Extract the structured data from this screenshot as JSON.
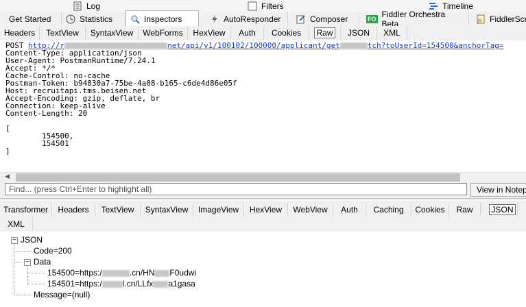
{
  "top_tabs": [
    {
      "label": "Log",
      "icon": "log-icon"
    },
    {
      "label": "Filters",
      "icon": "filters-checkbox-icon"
    },
    {
      "label": "Timeline",
      "icon": "timeline-icon"
    }
  ],
  "main_tabs": [
    {
      "label": "Get Started",
      "icon": ""
    },
    {
      "label": "Statistics",
      "icon": "statistics-icon"
    },
    {
      "label": "Inspectors",
      "icon": "inspectors-icon"
    },
    {
      "label": "AutoResponder",
      "icon": "lightning-icon"
    },
    {
      "label": "Composer",
      "icon": "composer-icon"
    },
    {
      "label": "Fiddler Orchestra Beta",
      "icon": "fo-badge-icon",
      "badge": "FO"
    },
    {
      "label": "FiddlerScrip",
      "icon": "fiddlerscript-icon"
    }
  ],
  "request_tabs": [
    "Headers",
    "TextView",
    "SyntaxView",
    "WebForms",
    "HexView",
    "Auth",
    "Cookies",
    "Raw",
    "JSON",
    "XML"
  ],
  "request": {
    "line1_prefix": "POST ",
    "line1_link": "http://r",
    "line1_mid": "net/api/v1/100102/100000/applicant/get",
    "line1_tail": "tch?toUserId=154500&anchorTag=",
    "headers": "Content-Type: application/json\nUser-Agent: PostmanRuntime/7.24.1\nAccept: */*\nCache-Control: no-cache\nPostman-Token: b94830a7-75be-4a08-b165-c6de4d86e05f\nHost: recruitapi.tms.beisen.net\nAccept-Encoding: gzip, deflate, br\nConnection: keep-alive\nContent-Length: 20",
    "body": "[\n        154500,\n        154501\n]"
  },
  "find": {
    "placeholder": "Find... (press Ctrl+Enter to highlight all)",
    "notepad_button": "View in Notepad"
  },
  "response_tabs_row1": [
    "Transformer",
    "Headers",
    "TextView",
    "SyntaxView",
    "ImageView",
    "HexView",
    "WebView",
    "Auth",
    "Caching",
    "Cookies",
    "Raw",
    "JSON"
  ],
  "response_tabs_row2": [
    "XML"
  ],
  "tree": {
    "root": "JSON",
    "code": "Code=200",
    "data": "Data",
    "item1_prefix": "154500=https:/",
    "item1_mid": ".cn/HN",
    "item1_tail": "F0udwi",
    "item2_prefix": "154501=https:/",
    "item2_mid": "l.cn/LLfx",
    "item2_tail": "a1gasa",
    "message": "Message=(null)"
  }
}
